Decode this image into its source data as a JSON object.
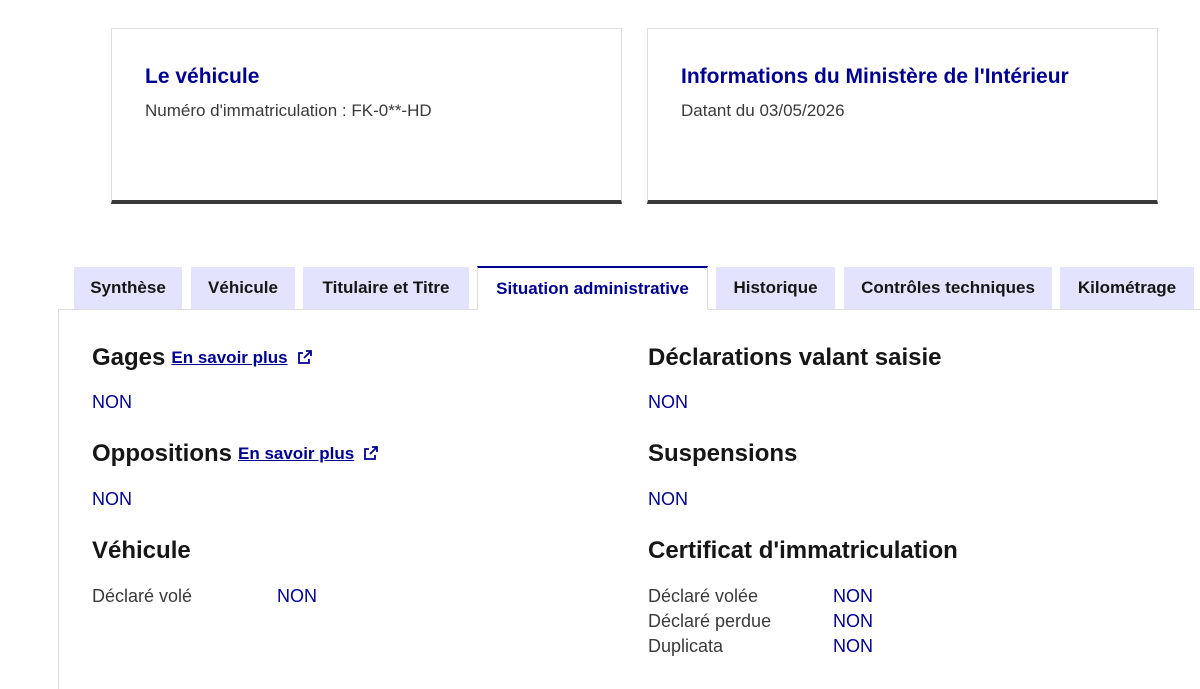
{
  "vehicle_card": {
    "title": "Le véhicule",
    "plate_text": "Numéro d'immatriculation : FK-0**-HD"
  },
  "ministry_card": {
    "title": "Informations du Ministère de l'Intérieur",
    "date_text": "Datant du 03/05/2026"
  },
  "tabs": [
    {
      "label": "Synthèse"
    },
    {
      "label": "Véhicule"
    },
    {
      "label": "Titulaire et Titre"
    },
    {
      "label": "Situation administrative"
    },
    {
      "label": "Historique"
    },
    {
      "label": "Contrôles techniques"
    },
    {
      "label": "Kilométrage"
    }
  ],
  "active_tab": "Situation administrative",
  "sections": {
    "gages": {
      "title": "Gages",
      "link": "En savoir plus",
      "value": "NON"
    },
    "oppositions": {
      "title": "Oppositions",
      "link": "En savoir plus",
      "value": "NON"
    },
    "vehicule": {
      "title": "Véhicule",
      "rows": [
        {
          "label": "Déclaré volé",
          "value": "NON"
        }
      ]
    },
    "declarations": {
      "title": "Déclarations valant saisie",
      "value": "NON"
    },
    "suspensions": {
      "title": "Suspensions",
      "value": "NON"
    },
    "certificat": {
      "title": "Certificat d'immatriculation",
      "rows": [
        {
          "label": "Déclaré volée",
          "value": "NON"
        },
        {
          "label": "Déclaré perdue",
          "value": "NON"
        },
        {
          "label": "Duplicata",
          "value": "NON"
        }
      ]
    }
  },
  "colors": {
    "primary": "#000091",
    "tab_bg": "#e3e3fd",
    "card_border_bottom": "#3a3a3a"
  },
  "icons": {
    "external_link": "external-link-icon"
  }
}
